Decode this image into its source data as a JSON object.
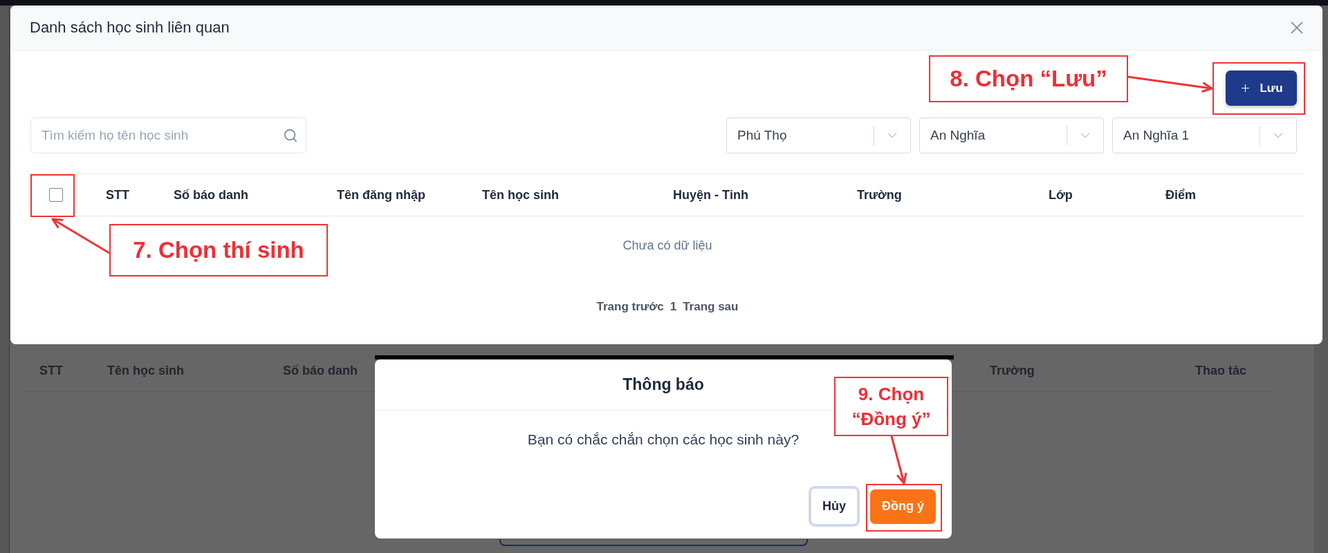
{
  "background_page": {
    "table": {
      "columns": [
        "STT",
        "Tên học sinh",
        "Số báo danh",
        "Trường",
        "Thao tác"
      ]
    }
  },
  "modal": {
    "title": "Danh sách học sinh liên quan",
    "save_button": {
      "label": "Lưu"
    },
    "search": {
      "placeholder": "Tìm kiếm họ tên học sinh"
    },
    "filters": [
      {
        "value": "Phú Thọ"
      },
      {
        "value": "An Nghĩa"
      },
      {
        "value": "An Nghĩa 1"
      }
    ],
    "table": {
      "select_all": {
        "checked": false
      },
      "columns": [
        "STT",
        "Số báo danh",
        "Tên đăng nhập",
        "Tên học sinh",
        "Huyện - Tỉnh",
        "Trường",
        "Lớp",
        "Điểm"
      ],
      "empty_text": "Chưa có dữ liệu"
    },
    "pagination": {
      "previous": "Trang trước",
      "pages": [
        "1"
      ],
      "next": "Trang sau"
    }
  },
  "confirm_dialog": {
    "title": "Thông báo",
    "message": "Bạn có chắc chắn chọn các học sinh này?",
    "buttons": [
      {
        "label": "Hủy",
        "kind": "secondary"
      },
      {
        "label": "Đồng ý",
        "kind": "primary"
      }
    ]
  },
  "annotations": [
    {
      "label": "7. Chọn thí sinh"
    },
    {
      "label": "8. Chọn “Lưu”"
    },
    {
      "label": "9. Chọn “Đồng ý”"
    }
  ]
}
